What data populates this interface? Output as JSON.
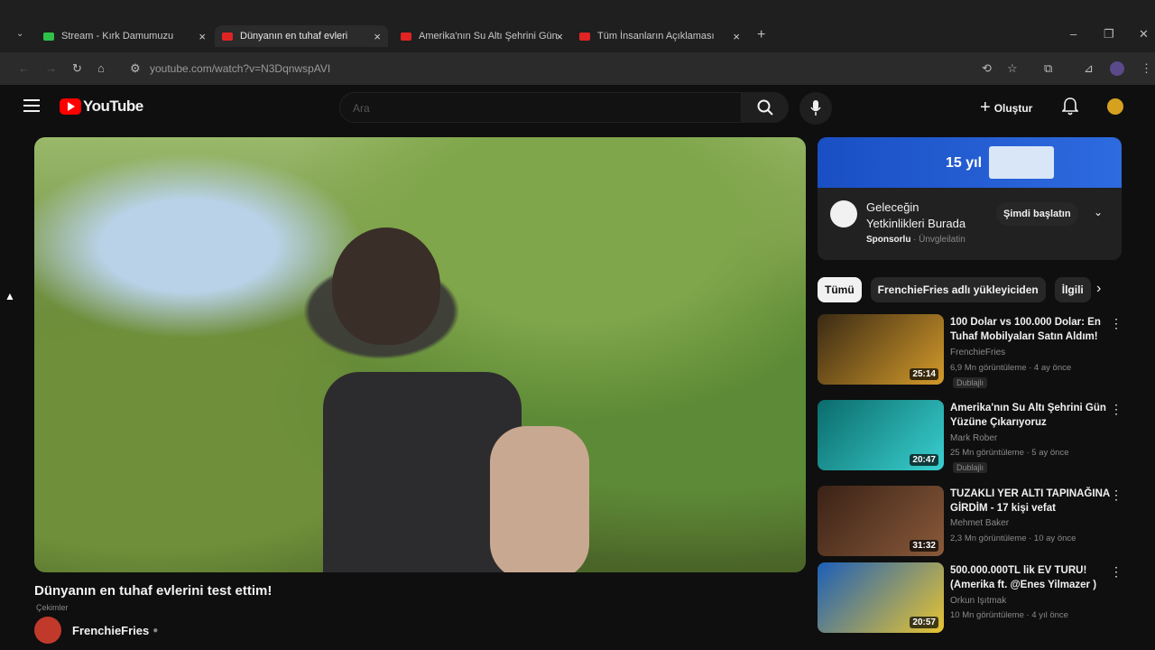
{
  "browser": {
    "tabs": [
      {
        "label": "Stream - Kırk Damumuzu",
        "favicon_color": "#2ec24a",
        "active": false
      },
      {
        "label": "Dünyanın en tuhaf evleri",
        "favicon_color": "#e02424",
        "active": true
      },
      {
        "label": "Amerika'nın Su Altı Şehrini Gün",
        "favicon_color": "#e02424",
        "active": false
      },
      {
        "label": "Tüm İnsanların Açıklaması",
        "favicon_color": "#e02424",
        "active": false
      }
    ],
    "url": "youtube.com/watch?v=N3DqnwspAVI"
  },
  "youtube": {
    "logo_text": "YouTube",
    "search_placeholder": "Ara",
    "create_label": "Oluştur",
    "brand_color": "#ff0000"
  },
  "video": {
    "title": "Dünyanın en tuhaf evlerini test ettim!",
    "subtitle": "Çekimler",
    "channel": "FrenchieFries"
  },
  "ad": {
    "banner_text": "15 yıl",
    "title_line1": "Geleceğin",
    "title_line2": "Yetkinlikleri Burada",
    "sponsor_label": "Sponsorlu",
    "sponsor_domain": "· Ünvgleilatin",
    "cta_label": "Şimdi başlatın"
  },
  "chips": [
    "Tümü",
    "FrenchieFries adlı yükleyiciden",
    "İlgili"
  ],
  "recommendations": [
    {
      "title": "100 Dolar vs 100.000 Dolar: En Tuhaf Mobilyaları Satın Aldım!",
      "channel": "FrenchieFries",
      "meta": "6,9 Mn görüntüleme · 4 ay önce",
      "badge": "Dublajlı",
      "duration": "25:14",
      "thumb_colors": [
        "#3a2a14",
        "#d39a2a"
      ]
    },
    {
      "title": "Amerika'nın Su Altı Şehrini Gün Yüzüne Çıkarıyoruz",
      "channel": "Mark Rober",
      "meta": "25 Mn görüntüleme · 5 ay önce",
      "badge": "Dublajlı",
      "duration": "20:47",
      "thumb_colors": [
        "#0b6b6b",
        "#3ad0d0"
      ]
    },
    {
      "title": "TUZAKLI YER ALTI TAPINAĞINA GİRDİM - 17 kişi vefat",
      "channel": "Mehmet Baker",
      "meta": "2,3 Mn görüntüleme · 10 ay önce",
      "badge": "",
      "duration": "31:32",
      "thumb_colors": [
        "#3a2216",
        "#8a5a3a"
      ]
    },
    {
      "title": "500.000.000TL lik EV TURU! (Amerika ft. @Enes Yilmazer )",
      "channel": "Orkun Işıtmak",
      "meta": "10 Mn görüntüleme · 4 yıl önce",
      "badge": "",
      "duration": "20:57",
      "thumb_colors": [
        "#1c5fb8",
        "#e8c431"
      ]
    }
  ]
}
